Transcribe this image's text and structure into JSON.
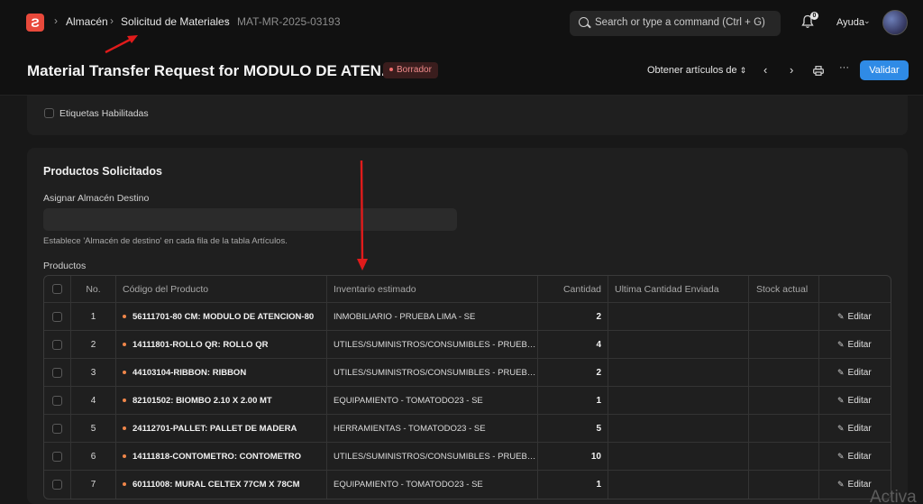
{
  "app": {
    "logo_letter": "Ƨ"
  },
  "breadcrumb": {
    "items": [
      "Almacén",
      "Solicitud de Materiales",
      "MAT-MR-2025-03193"
    ],
    "separator": "›"
  },
  "search": {
    "placeholder": "Search or type a command (Ctrl + G)"
  },
  "notifications": {
    "count": "0"
  },
  "help": {
    "label": "Ayuda"
  },
  "header": {
    "title": "Material Transfer Request for MODULO DE ATEN...",
    "status": "Borrador",
    "get_items_label": "Obtener artículos de",
    "submit_label": "Validar",
    "more_label": "···"
  },
  "options": {
    "enabled_labels": "Etiquetas Habilitadas"
  },
  "section": {
    "title": "Productos Solicitados",
    "target_label": "Asignar Almacén Destino",
    "target_value": "",
    "help_text": "Establece 'Almacén de destino' en cada fila de la tabla Artículos.",
    "products_label": "Productos"
  },
  "table": {
    "headers": [
      "No.",
      "Código del Producto",
      "Inventario estimado",
      "Cantidad",
      "Ultima Cantidad Enviada",
      "Stock actual"
    ],
    "edit_label": "Editar",
    "rows": [
      {
        "no": "1",
        "code": "56111701-80 CM: MODULO DE ATENCION-80",
        "inventory": "INMOBILIARIO - PRUEBA LIMA - SE",
        "qty": "2"
      },
      {
        "no": "2",
        "code": "14111801-ROLLO QR: ROLLO QR",
        "inventory": "UTILES/SUMINISTROS/CONSUMIBLES - PRUEBA LIMA - SE",
        "qty": "4"
      },
      {
        "no": "3",
        "code": "44103104-RIBBON: RIBBON",
        "inventory": "UTILES/SUMINISTROS/CONSUMIBLES - PRUEBA LIMA - SE",
        "qty": "2"
      },
      {
        "no": "4",
        "code": "82101502: BIOMBO 2.10 X 2.00 MT",
        "inventory": "EQUIPAMIENTO - TOMATODO23 - SE",
        "qty": "1"
      },
      {
        "no": "5",
        "code": "24112701-PALLET: PALLET DE MADERA",
        "inventory": "HERRAMIENTAS - TOMATODO23 - SE",
        "qty": "5"
      },
      {
        "no": "6",
        "code": "14111818-CONTOMETRO: CONTOMETRO",
        "inventory": "UTILES/SUMINISTROS/CONSUMIBLES - PRUEBA LIMA - SE",
        "qty": "10"
      },
      {
        "no": "7",
        "code": "60111008: MURAL CELTEX 77CM X 78CM",
        "inventory": "EQUIPAMIENTO - TOMATODO23 - SE",
        "qty": "1"
      }
    ]
  },
  "watermark": {
    "text": "Activa"
  },
  "colors": {
    "accent": "#2f8be6",
    "brand": "#e8493b",
    "annotation_arrow": "#e01b1b",
    "status_draft": "#f08a8a",
    "item_dot": "#f0864a"
  }
}
